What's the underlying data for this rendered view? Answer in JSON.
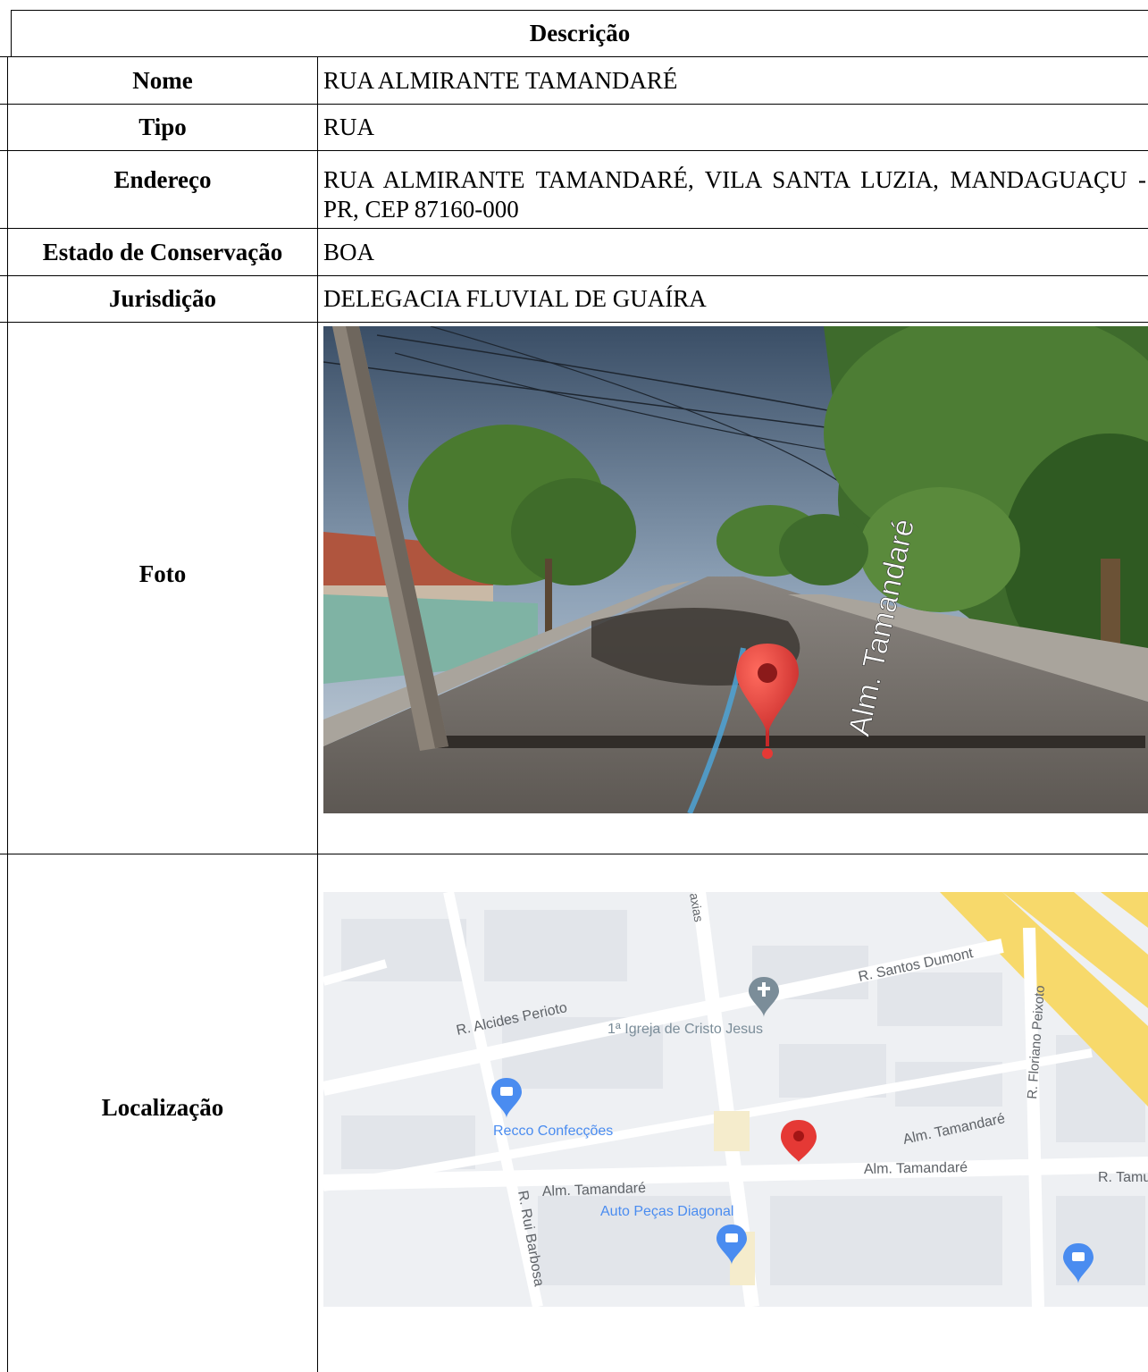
{
  "header": {
    "title": "Descrição"
  },
  "rows": [
    {
      "label": "Nome",
      "value": "RUA ALMIRANTE TAMANDARÉ"
    },
    {
      "label": "Tipo",
      "value": "RUA"
    },
    {
      "label": "Endereço",
      "value": "RUA ALMIRANTE TAMANDARÉ, VILA SANTA LUZIA, MANDAGUAÇU - PR, CEP 87160-000"
    },
    {
      "label": "Estado de Conservação",
      "value": "BOA"
    },
    {
      "label": "Jurisdição",
      "value": "DELEGACIA FLUVIAL DE GUAÍRA"
    },
    {
      "label": "Foto"
    },
    {
      "label": "Localização"
    }
  ],
  "photo": {
    "street_sign": "Alm. Tamandaré"
  },
  "map": {
    "streets": [
      "R. Alcides Perioto",
      "R. Santos Dumont",
      "R. Floriano Peixoto",
      "Alm. Tamandaré",
      "Alm. Tamandaré",
      "Alm. Tamandaré",
      "R. Rui Barbosa",
      "R. Tamu",
      "axias"
    ],
    "places": [
      "1ª Igreja de Cristo Jesus",
      "Recco Confecções",
      "Auto Peças Diagonal"
    ],
    "colors": {
      "background": "#eef0f3",
      "road": "#ffffff",
      "highway": "#f7d96b",
      "pin": "#e53935",
      "poi": "#4a8cf0",
      "church": "#7b8d99"
    }
  }
}
